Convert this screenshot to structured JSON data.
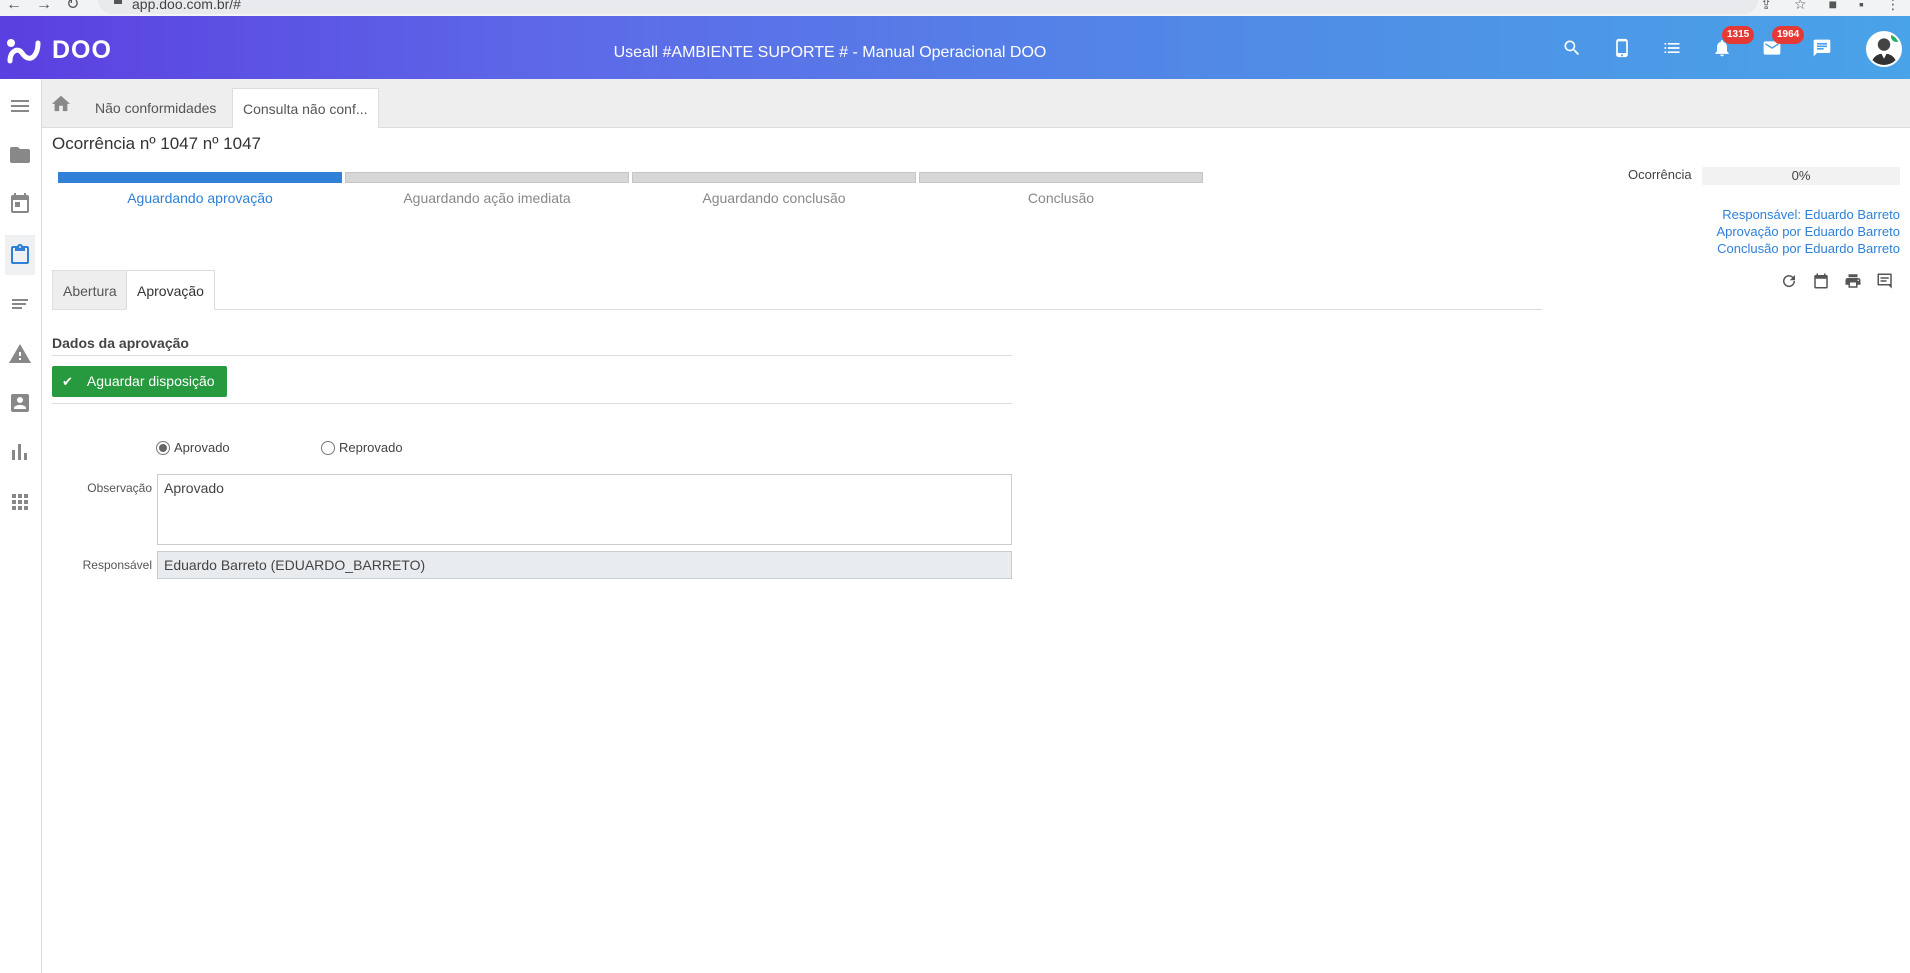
{
  "browser": {
    "url": "app.doo.com.br/#"
  },
  "header": {
    "logo_text": "DOO",
    "title": "Useall #AMBIENTE SUPORTE # - Manual Operacional DOO",
    "notifications_badge": "1315",
    "messages_badge": "1964"
  },
  "tabs": {
    "items": [
      {
        "label": "Não conformidades"
      },
      {
        "label": "Consulta não conf..."
      }
    ]
  },
  "page": {
    "title": "Ocorrência nº 1047 nº 1047"
  },
  "progress": {
    "steps": [
      {
        "label": "Aguardando aprovação",
        "done": true
      },
      {
        "label": "Aguardando ação imediata",
        "done": false
      },
      {
        "label": "Aguardando conclusão",
        "done": false
      },
      {
        "label": "Conclusão",
        "done": false
      }
    ]
  },
  "occurrence": {
    "label": "Ocorrência",
    "percent": "0%"
  },
  "responsibles": {
    "responsavel": "Responsável: Eduardo Barreto",
    "aprovacao": "Aprovação por Eduardo Barreto",
    "conclusao": "Conclusão por Eduardo Barreto"
  },
  "content_tabs": {
    "abertura": "Abertura",
    "aprovacao": "Aprovação"
  },
  "approval": {
    "section_title": "Dados da aprovação",
    "button_label": "Aguardar disposição",
    "radio_aprovado": "Aprovado",
    "radio_reprovado": "Reprovado",
    "selected": "Aprovado",
    "obs_label": "Observação",
    "obs_value": "Aprovado",
    "resp_label": "Responsável",
    "resp_value": "Eduardo Barreto  (EDUARDO_BARRETO)"
  },
  "colors": {
    "accent": "#2f80d6",
    "success": "#279a3f",
    "header_from": "#5b3fe0",
    "header_to": "#49a3e8",
    "badge": "#e53935"
  }
}
